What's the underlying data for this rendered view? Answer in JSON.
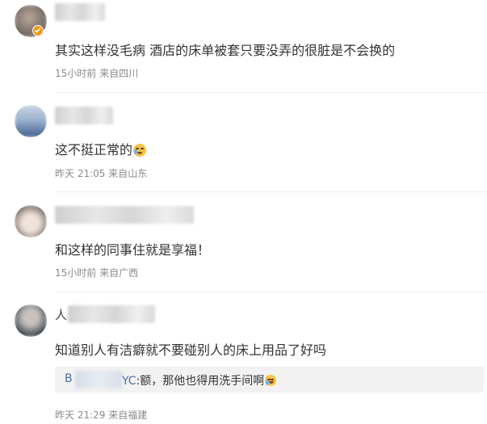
{
  "comments": [
    {
      "username_visible": "",
      "text": "其实这样没毛病 酒店的床单被套只要没弄的很脏是不会换的",
      "meta": "15小时前 来自四川",
      "verified": true
    },
    {
      "username_visible": "",
      "text": "这不挺正常的",
      "emoji": "crying-face",
      "meta": "昨天 21:05 来自山东"
    },
    {
      "username_visible": "",
      "text": "和这样的同事住就是享福！",
      "meta": "15小时前 来自广西"
    },
    {
      "username_visible": "人",
      "text": "知道别人有洁癖就不要碰别人的床上用品了好吗",
      "reply": {
        "name_start": "B",
        "name_end": "YC",
        "text": ":额，那他也得用洗手间啊",
        "emoji": "laughing-tears-face"
      },
      "meta": "昨天 21:29 来自福建"
    }
  ],
  "colors": {
    "text": "#333333",
    "meta": "#8a8a8a",
    "reply_bg": "#f2f2f2",
    "reply_name": "#4a6ea8",
    "divider": "#eeeeee",
    "verified_badge": "#f29a1e"
  }
}
